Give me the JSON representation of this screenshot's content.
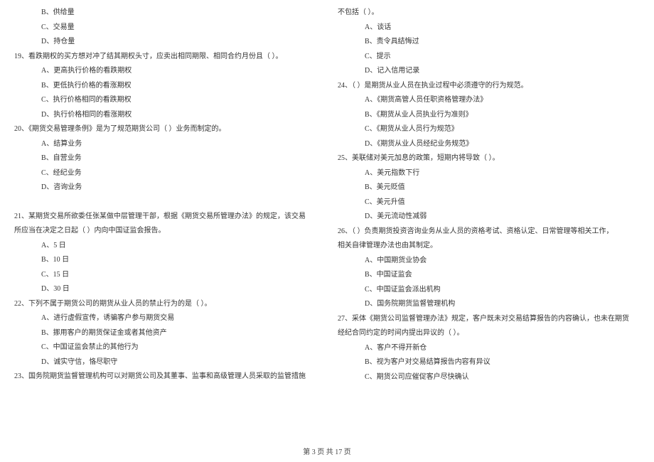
{
  "left_column": {
    "q18_opts": [
      "B、供给量",
      "C、交易量",
      "D、持仓量"
    ],
    "q19": "19、看跌期权的买方想对冲了结其期权头寸，应卖出相同期限、相同合约月份且（    ）。",
    "q19_opts": [
      "A、更高执行价格的看跌期权",
      "B、更低执行价格的看涨期权",
      "C、执行价格相同的看跌期权",
      "D、执行价格相同的看涨期权"
    ],
    "q20": "20、《期货交易管理条例》是为了规范期货公司（    ）业务而制定的。",
    "q20_opts": [
      "A、结算业务",
      "B、自营业务",
      "C、经纪业务",
      "D、咨询业务"
    ],
    "q21_l1": "21、某期货交易所欲委任张某做中层管理干部，根据《期货交易所管理办法》的规定，该交易",
    "q21_l2": "所应当在决定之日起（    ）内向中国证监会报告。",
    "q21_opts": [
      "A、5 日",
      "B、10 日",
      "C、15 日",
      "D、30 日"
    ],
    "q22": "22、下列不属于期货公司的期货从业人员的禁止行为的是（    ）。",
    "q22_opts": [
      "A、进行虚假宣传，诱骗客户参与期货交易",
      "B、挪用客户的期货保证金或者其他资产",
      "C、中国证监会禁止的其他行为",
      "D、诚实守信，恪尽职守"
    ],
    "q23": "23、国务院期货监督管理机构可以对期货公司及其董事、监事和高级管理人员采取的监管措施"
  },
  "right_column": {
    "q23_cont": "不包括（    ）。",
    "q23_opts": [
      "A、谈话",
      "B、责令具结悔过",
      "C、提示",
      "D、记入信用记录"
    ],
    "q24": "24、（    ）是期货从业人员在执业过程中必须遵守的行为规范。",
    "q24_opts": [
      "A、《期货高管人员任职资格管理办法》",
      "B、《期货从业人员执业行为准则》",
      "C、《期货从业人员行为规范》",
      "D、《期货从业人员经纪业务规范》"
    ],
    "q25": "25、美联储对美元加息的政策，短期内将导致（    ）。",
    "q25_opts": [
      "A、美元指数下行",
      "B、美元贬值",
      "C、美元升值",
      "D、美元流动性减弱"
    ],
    "q26_l1": "26、（    ）负责期货投资咨询业务从业人员的资格考试、资格认定、日常管理等相关工作，",
    "q26_l2": "相关自律管理办法也由其制定。",
    "q26_opts": [
      "A、中国期货业协会",
      "B、中国证监会",
      "C、中国证监会派出机构",
      "D、国务院期货监督管理机构"
    ],
    "q27_l1": "27、采体《期货公司监督管理办法》规定，客户既未对交易结算报告的内容确认，也未在期货",
    "q27_l2": "经纪合同约定的时间内提出异议的（    ）。",
    "q27_opts": [
      "A、客户不得开新仓",
      "B、视为客户对交易结算报告内容有异议",
      "C、期货公司应催促客户尽快确认"
    ]
  },
  "footer": "第 3 页 共 17 页"
}
